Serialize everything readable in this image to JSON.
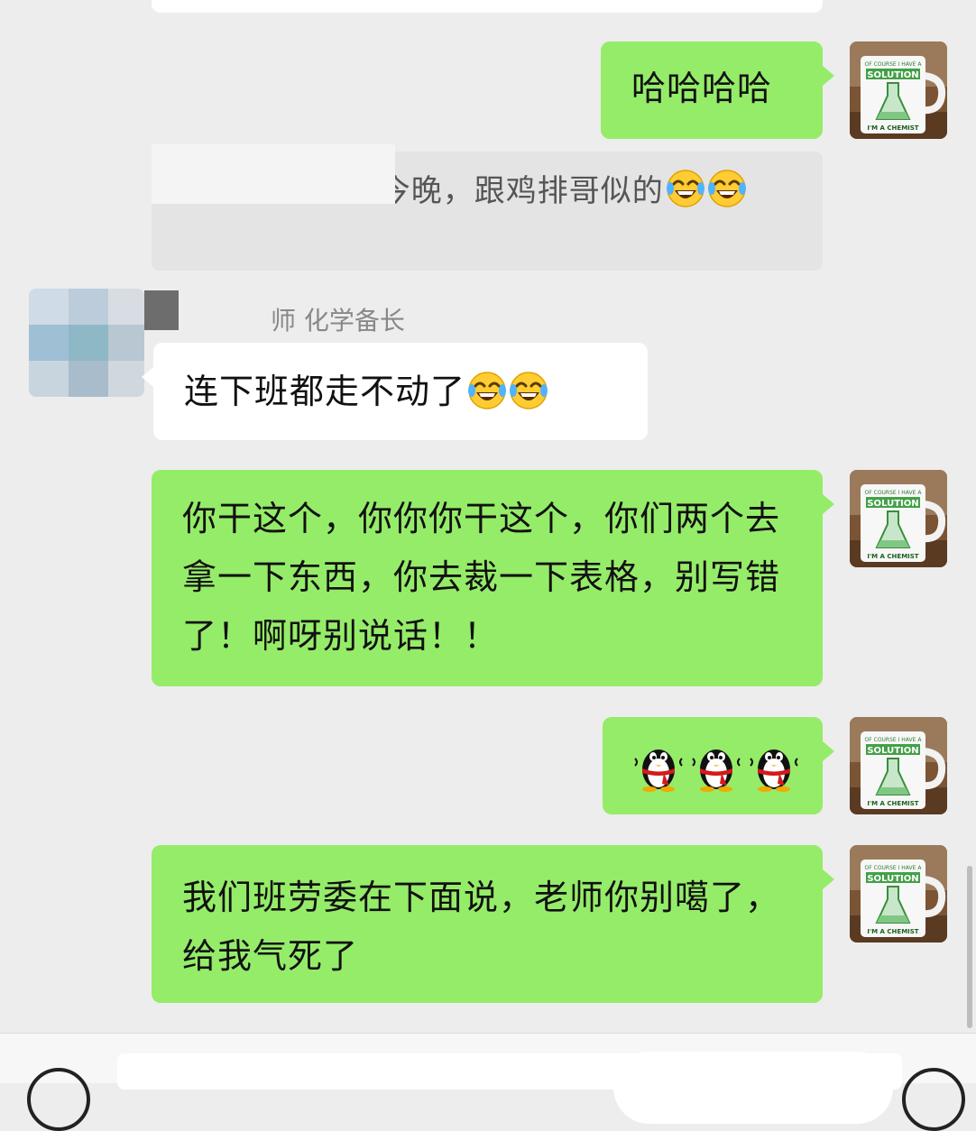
{
  "messages": {
    "m1": "哈哈哈哈",
    "quote": "学备长：忙s了今晚，跟鸡排哥似的",
    "sender": "师 化学备长",
    "m2": "连下班都走不动了",
    "m3": "你干这个，你你你干这个，你们两个去拿一下东西，你去裁一下表格，别写错了！啊呀别说话！！",
    "m5": "我们班劳委在下面说，老师你别噶了，给我气死了"
  },
  "avatar": {
    "mug_top": "OF COURSE I HAVE A",
    "mug_main": "SOLUTION",
    "mug_bottom": "I'M A CHEMIST"
  },
  "colors": {
    "chat_bg": "#ededed",
    "my_bubble": "#95ec69",
    "other_bubble": "#ffffff",
    "quote_bg": "#e4e4e4"
  },
  "icons": [
    "laughing-tears-emoji",
    "qq-penguin-emoji",
    "voice-icon",
    "plus-icon"
  ]
}
